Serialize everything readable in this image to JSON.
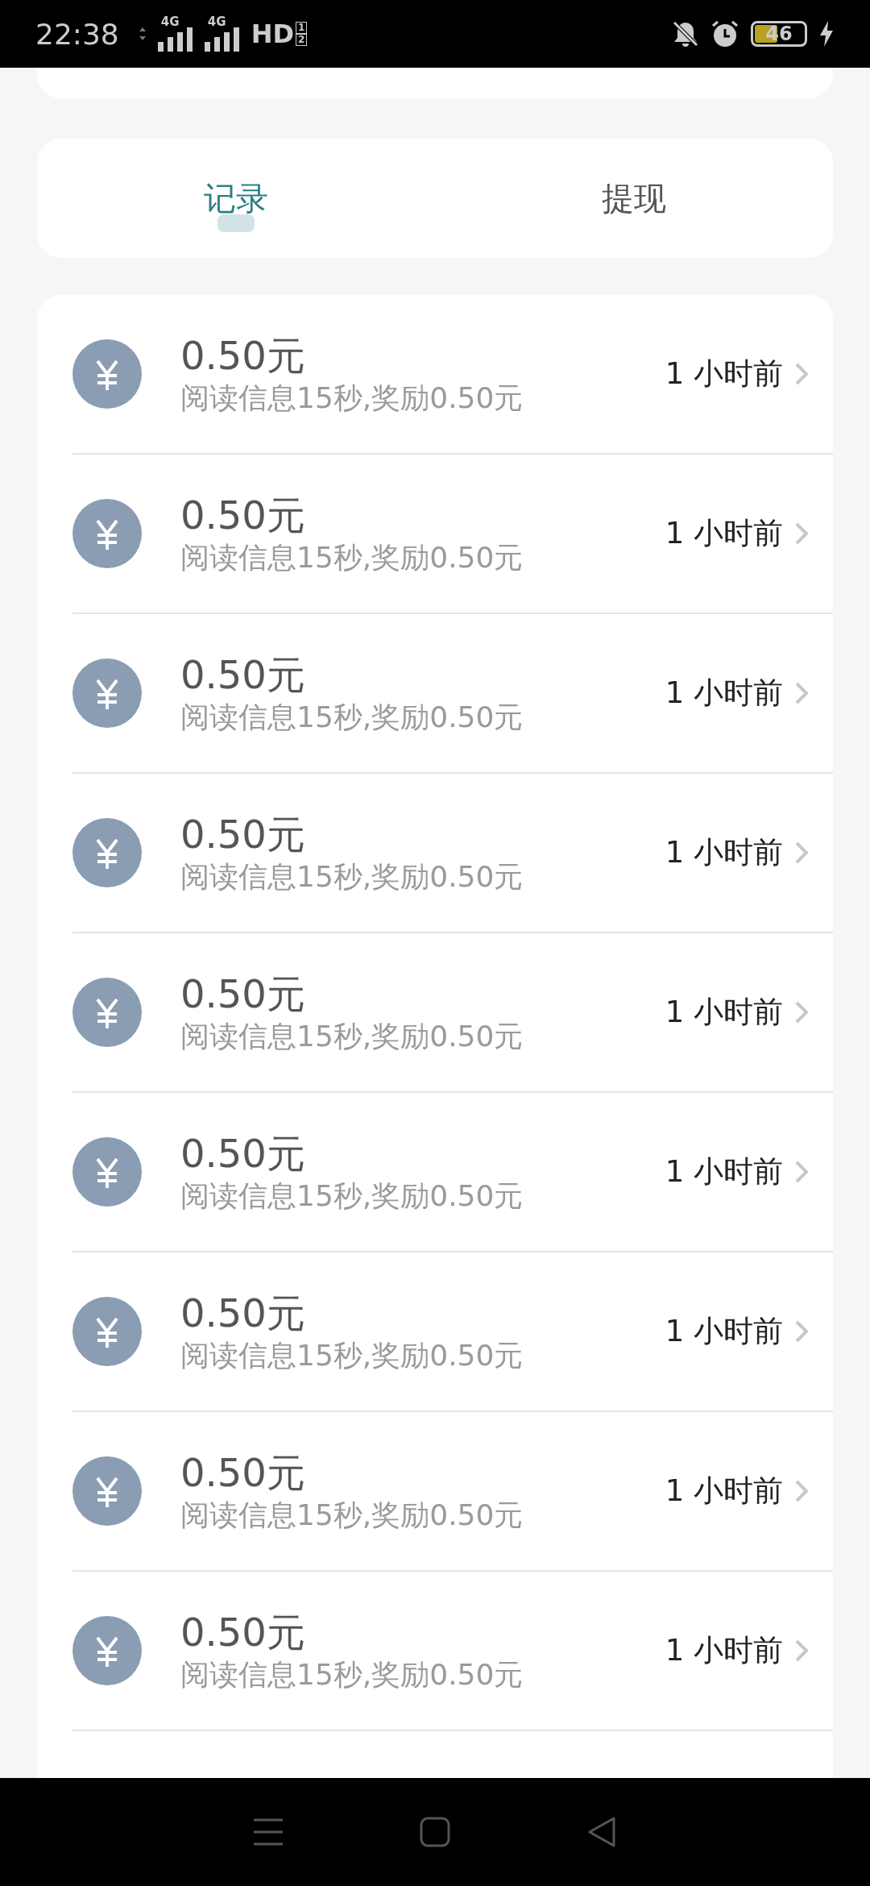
{
  "status_bar": {
    "time": "22:38",
    "sim_1": "4G",
    "sim_2": "4G",
    "hd": "HD",
    "hd_slots": [
      "1",
      "2"
    ],
    "battery": "46"
  },
  "tabs": [
    {
      "label": "记录",
      "selected": true
    },
    {
      "label": "提现",
      "selected": false
    }
  ],
  "records": [
    {
      "amount": "0.50元",
      "description": "阅读信息15秒,奖励0.50元",
      "time": "1 小时前"
    },
    {
      "amount": "0.50元",
      "description": "阅读信息15秒,奖励0.50元",
      "time": "1 小时前"
    },
    {
      "amount": "0.50元",
      "description": "阅读信息15秒,奖励0.50元",
      "time": "1 小时前"
    },
    {
      "amount": "0.50元",
      "description": "阅读信息15秒,奖励0.50元",
      "time": "1 小时前"
    },
    {
      "amount": "0.50元",
      "description": "阅读信息15秒,奖励0.50元",
      "time": "1 小时前"
    },
    {
      "amount": "0.50元",
      "description": "阅读信息15秒,奖励0.50元",
      "time": "1 小时前"
    },
    {
      "amount": "0.50元",
      "description": "阅读信息15秒,奖励0.50元",
      "time": "1 小时前"
    },
    {
      "amount": "0.50元",
      "description": "阅读信息15秒,奖励0.50元",
      "time": "1 小时前"
    },
    {
      "amount": "0.50元",
      "description": "阅读信息15秒,奖励0.50元",
      "time": "1 小时前"
    }
  ]
}
